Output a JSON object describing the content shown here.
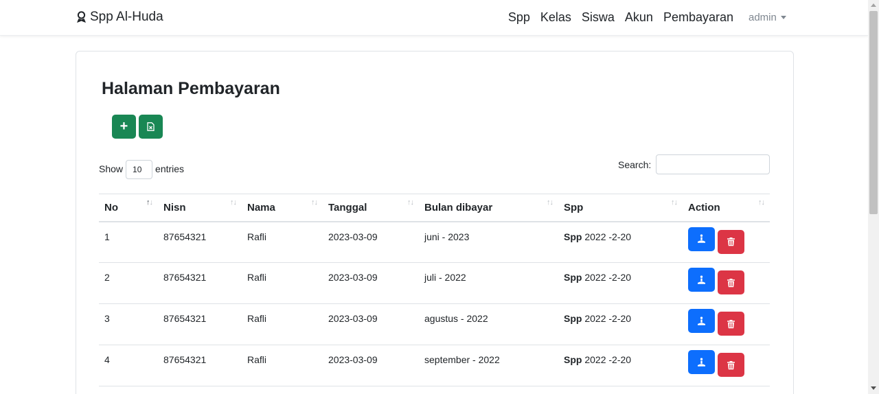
{
  "navbar": {
    "brand": "Spp Al-Huda",
    "links": [
      "Spp",
      "Kelas",
      "Siswa",
      "Akun",
      "Pembayaran"
    ],
    "user": "admin"
  },
  "page": {
    "title": "Halaman Pembayaran"
  },
  "datatable": {
    "show_label": "Show",
    "entries_value": "10",
    "entries_label": "entries",
    "search_label": "Search:",
    "search_value": ""
  },
  "table": {
    "headers": [
      "No",
      "Nisn",
      "Nama",
      "Tanggal",
      "Bulan dibayar",
      "Spp",
      "Action"
    ],
    "rows": [
      {
        "no": "1",
        "nisn": "87654321",
        "nama": "Rafli",
        "tanggal": "2023-03-09",
        "bulan": "juni - 2023",
        "spp_label": "Spp",
        "spp_value": "2022 -2-20"
      },
      {
        "no": "2",
        "nisn": "87654321",
        "nama": "Rafli",
        "tanggal": "2023-03-09",
        "bulan": "juli - 2022",
        "spp_label": "Spp",
        "spp_value": "2022 -2-20"
      },
      {
        "no": "3",
        "nisn": "87654321",
        "nama": "Rafli",
        "tanggal": "2023-03-09",
        "bulan": "agustus - 2022",
        "spp_label": "Spp",
        "spp_value": "2022 -2-20"
      },
      {
        "no": "4",
        "nisn": "87654321",
        "nama": "Rafli",
        "tanggal": "2023-03-09",
        "bulan": "september - 2022",
        "spp_label": "Spp",
        "spp_value": "2022 -2-20"
      }
    ]
  },
  "colors": {
    "green": "#198754",
    "blue": "#0d6efd",
    "red": "#dc3545"
  },
  "icons": {
    "brand": "user-award-icon",
    "add": "plus-icon",
    "excel": "file-excel-icon",
    "info": "print-icon",
    "delete": "trash-icon"
  }
}
